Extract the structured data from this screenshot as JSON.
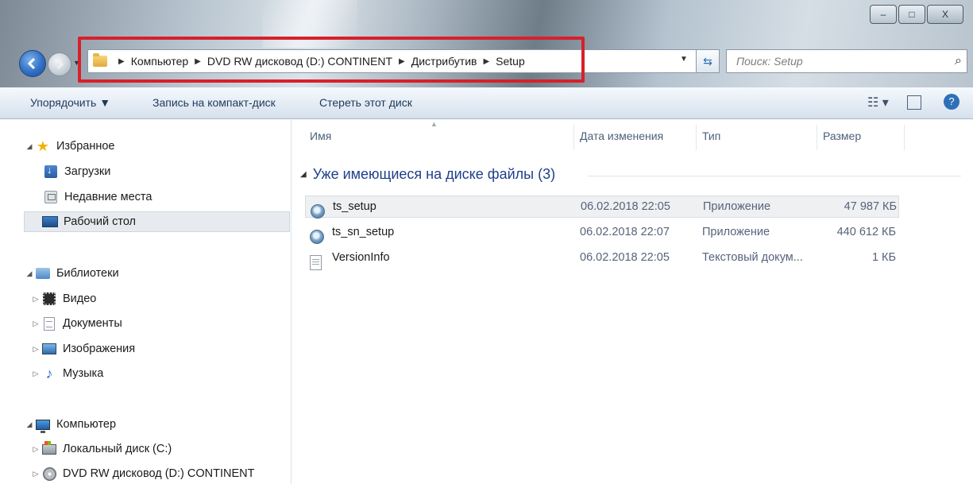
{
  "window": {
    "controls": {
      "minimize": "–",
      "maximize": "□",
      "close": "X"
    }
  },
  "address": {
    "crumbs": [
      "Компьютер",
      "DVD RW дисковод (D:) CONTINENT",
      "Дистрибутив",
      "Setup"
    ]
  },
  "search": {
    "placeholder": "Поиск: Setup"
  },
  "toolbar": {
    "organize": "Упорядочить ▼",
    "burn": "Запись на компакт-диск",
    "erase": "Стереть этот диск",
    "icons": [
      "view-options-icon",
      "preview-pane-icon",
      "help-icon"
    ]
  },
  "nav": {
    "favorites": {
      "label": "Избранное",
      "items": [
        "Загрузки",
        "Недавние места",
        "Рабочий стол"
      ],
      "selected": "Рабочий стол"
    },
    "libraries": {
      "label": "Библиотеки",
      "items": [
        "Видео",
        "Документы",
        "Изображения",
        "Музыка"
      ]
    },
    "computer": {
      "label": "Компьютер",
      "items": [
        "Локальный диск (C:)",
        "DVD RW дисковод (D:) CONTINENT"
      ]
    }
  },
  "columns": {
    "name": "Имя",
    "date": "Дата изменения",
    "type": "Тип",
    "size": "Размер"
  },
  "group": {
    "title": "Уже имеющиеся на диске файлы (3)"
  },
  "files": [
    {
      "name": "ts_setup",
      "date": "06.02.2018 22:05",
      "type": "Приложение",
      "size": "47 987 КБ",
      "icon": "exe-icon"
    },
    {
      "name": "ts_sn_setup",
      "date": "06.02.2018 22:07",
      "type": "Приложение",
      "size": "440 612 КБ",
      "icon": "exe-icon"
    },
    {
      "name": "VersionInfo",
      "date": "06.02.2018 22:05",
      "type": "Текстовый докум...",
      "size": "1 КБ",
      "icon": "text-file-icon"
    }
  ],
  "colors": {
    "highlight": "#d8202a",
    "group_title": "#1e3f8a",
    "column_header": "#4c607a"
  }
}
